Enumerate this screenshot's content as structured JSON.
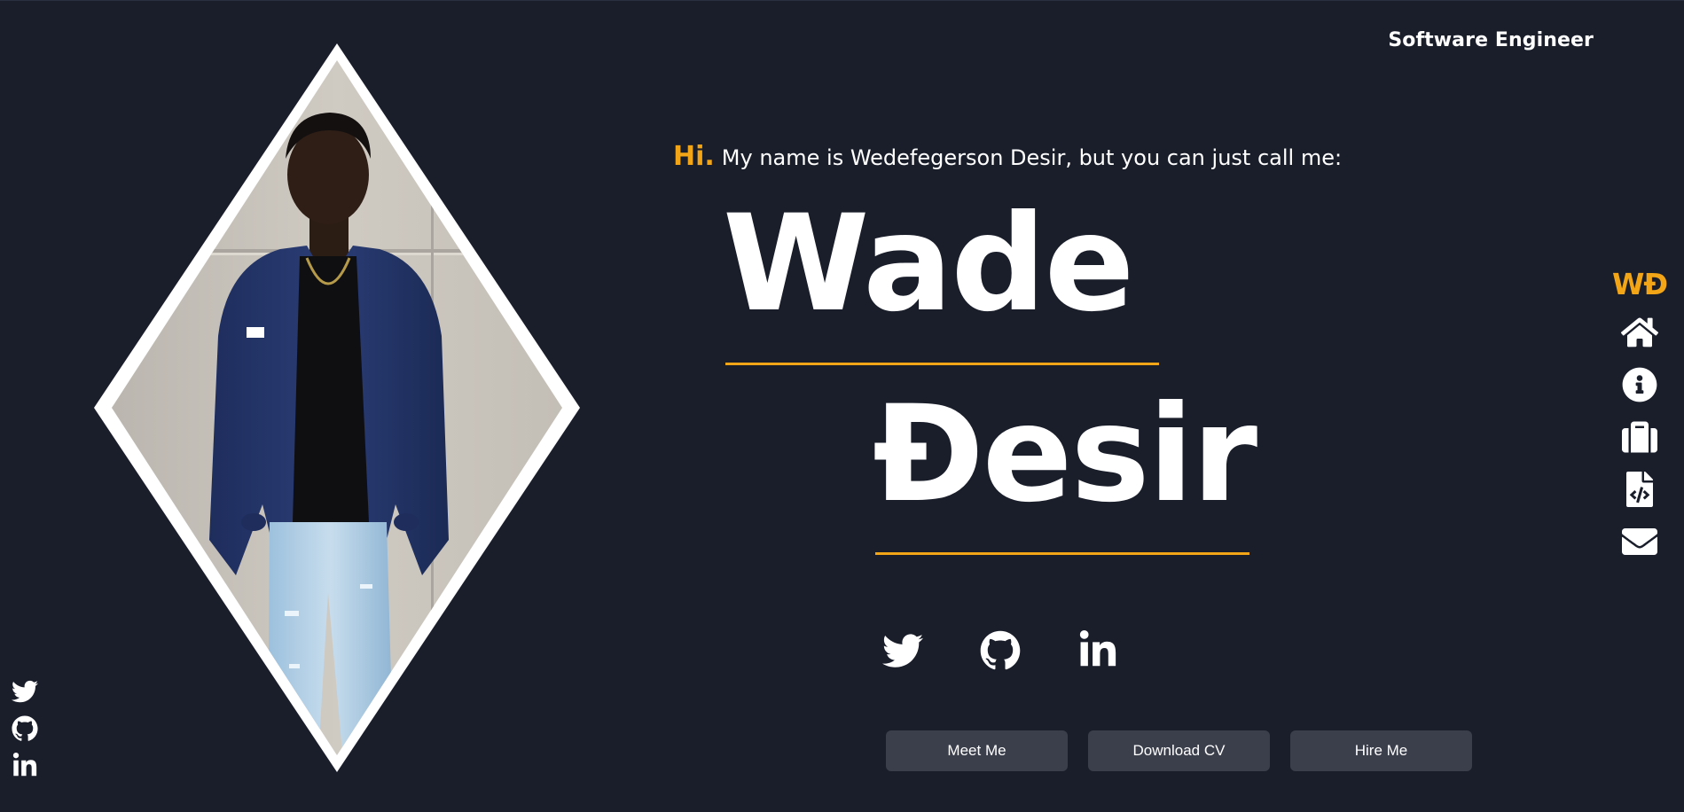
{
  "header": {
    "tagline": "Software Engineer"
  },
  "intro": {
    "greeting": "Hi.",
    "text": "My name is Wedefegerson Desir, but you can just call me:"
  },
  "name": {
    "first": "Wade",
    "last": "Đesir"
  },
  "social": [
    {
      "icon": "twitter-icon"
    },
    {
      "icon": "github-icon"
    },
    {
      "icon": "linkedin-icon"
    }
  ],
  "buttons": {
    "meet": "Meet Me",
    "cv": "Download CV",
    "hire": "Hire Me"
  },
  "nav": {
    "logo": "WĐ",
    "items": [
      {
        "icon": "home-icon"
      },
      {
        "icon": "info-icon"
      },
      {
        "icon": "briefcase-icon"
      },
      {
        "icon": "code-file-icon"
      },
      {
        "icon": "envelope-icon"
      }
    ]
  },
  "colors": {
    "background": "#1a1e2b",
    "accent": "#f2a516",
    "button": "#3b3f4c",
    "text": "#ffffff"
  }
}
